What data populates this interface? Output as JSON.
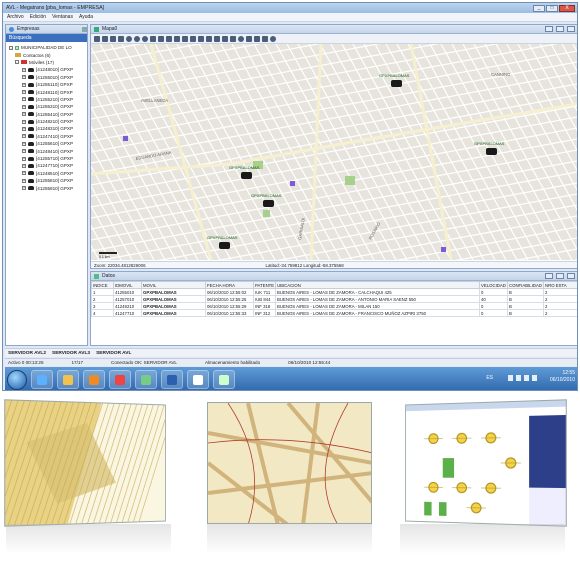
{
  "window": {
    "title": "AVL - Megatrans [pba_lomas - EMPRESA]",
    "buttons": [
      "_",
      "□",
      "X"
    ]
  },
  "menu": [
    "Archivo",
    "Edición",
    "Ventanas",
    "Ayuda"
  ],
  "left_panel": {
    "title": "Empresas",
    "search_label": "Búsqueda",
    "root": "MUNICIPALIDAD DE LO",
    "contactos": "Contactos (6)",
    "moviles": "Móviles (17)",
    "items": [
      "[41248010] GPXP",
      "[41255010] GPXP",
      "[41255110] GPXP",
      "[41248110] GPXP",
      "[41255210] GPXP",
      "[41255310] GPXP",
      "[41255410] GPXP",
      "[41248210] GPXP",
      "[41248310] GPXP",
      "[41247410] GPXP",
      "[41255610] GPXP",
      "[41248410] GPXP",
      "[41255710] GPXP",
      "[41247710] GPXP",
      "[41248510] GPXP",
      "[41255810] GPXP",
      "[41255910] GPXP"
    ]
  },
  "map_window": {
    "title": "Mapa0",
    "zoom_text": "Zoom: 22034.4812826006",
    "coords_text": "Latitud:-34.759812 Longitud:-58.375568",
    "vehicle_label": "GPXPBALOMAS",
    "street_labels": [
      "AVELLANEDA",
      "CANNING",
      "EDUARDO ARANA",
      "ROSARIO",
      "GARIBALDI",
      "AUTODROMO DE LA PLATA"
    ],
    "scale_label": "0     1 km"
  },
  "data_window": {
    "title": "Datos",
    "columns": [
      "INDICE",
      "IDMOVIL",
      "MOVIL",
      "FECHA HORA",
      "PATENTE",
      "UBICACION",
      "VELOCIDAD",
      "CONFIABILIDAD",
      "NRO ESTA"
    ],
    "rows": [
      [
        "1",
        "41255010",
        "GPXPBALOMAS",
        "06/10/2010 12:55:02",
        "IUK 711",
        "BUENOS AIRES - LOMAS DE ZAMORA - CALCHAQUI 425",
        "0",
        "B",
        "2"
      ],
      [
        "2",
        "41257010",
        "GPXPBALOMAS",
        "06/10/2010 12:55:25",
        "IUB 844",
        "BUENOS AIRES - LOMAS DE ZAMORA - ANTONIO MARIA SAENZ 550",
        "40",
        "B",
        "2"
      ],
      [
        "3",
        "41249210",
        "GPXPBALOMAS",
        "06/10/2010 12:55:29",
        "INF 318",
        "BUENOS AIRES - LOMAS DE ZAMORA - MILAN 150",
        "0",
        "B",
        "2"
      ],
      [
        "4",
        "41247710",
        "GPXPBALOMAS",
        "06/10/2010 12:55:33",
        "INF 312",
        "BUENOS AIRES - LOMAS DE ZAMORA - FRANCISCO MUÑOZ AZPIRI 3750",
        "0",
        "B",
        "2"
      ]
    ]
  },
  "servers": [
    "SERVIDOR AVL2",
    "SERVIDOR AVL3",
    "SERVIDOR AVL"
  ],
  "status": {
    "activo": "Activo 0 00:13:25",
    "count": "17/17",
    "conectado": "Conectado OK: SERVIDOR AVL",
    "almacenamiento": "Almacenamiento habilitado",
    "fecha": "06/10/2010 12:55:44"
  },
  "taskbar": {
    "lang": "ES",
    "time": "12:55",
    "date": "06/10/2010"
  },
  "colors": {
    "map_bg": "#e7e4dd",
    "street": "#ffffff",
    "park": "#a7d08c",
    "taskbar": "#3a74b8"
  }
}
